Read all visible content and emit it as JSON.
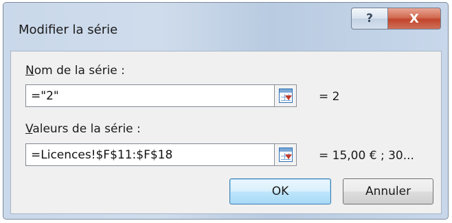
{
  "window": {
    "title": "Modifier la série",
    "help_glyph": "?",
    "close_glyph": "X"
  },
  "series_name": {
    "label_accel": "N",
    "label_rest": "om de la série :",
    "value": "=\"2\"",
    "result": "= 2"
  },
  "series_values": {
    "label_accel": "V",
    "label_rest": "aleurs de la série :",
    "value": "=Licences!$F$11:$F$18",
    "result": "= 15,00 € ; 30..."
  },
  "buttons": {
    "ok_label": "OK",
    "cancel_label": "Annuler"
  },
  "icons": {
    "collapse": "range-collapse-icon"
  }
}
